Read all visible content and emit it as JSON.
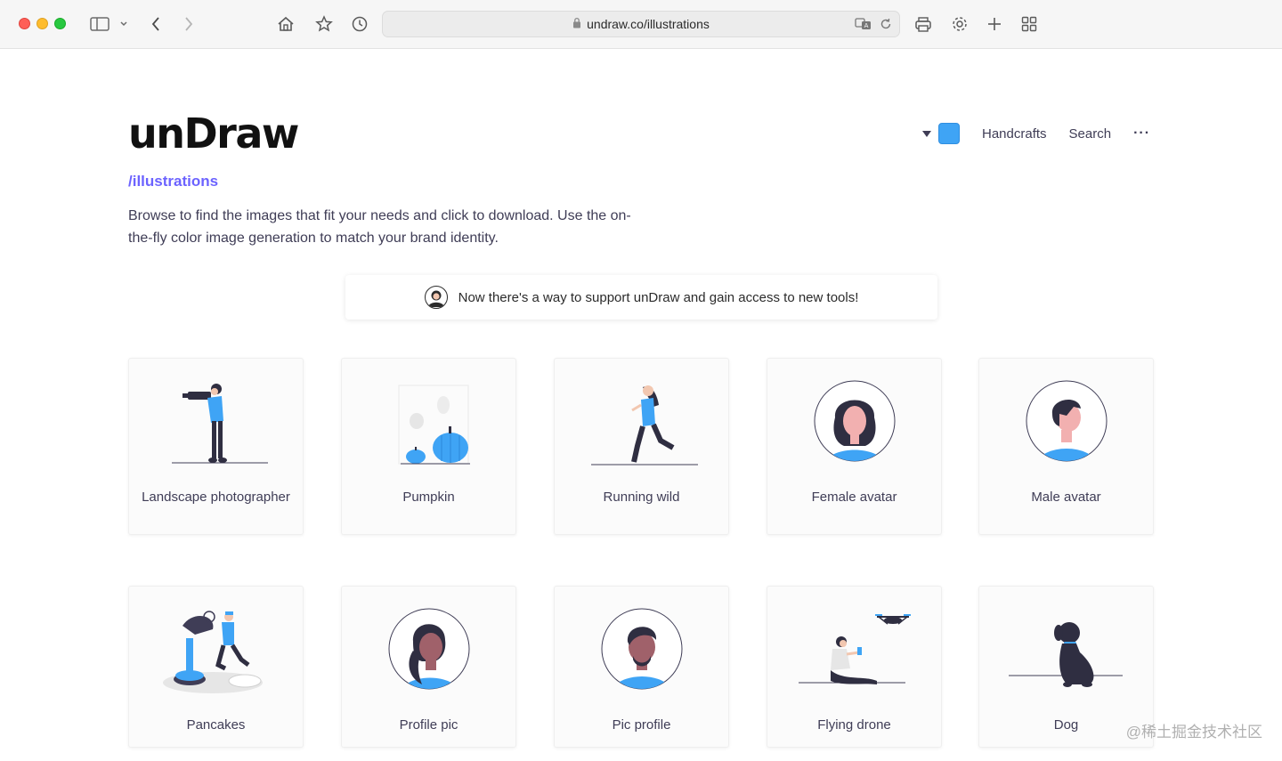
{
  "browser": {
    "url": "undraw.co/illustrations",
    "lock_icon": "lock-icon",
    "translate_icon": "translate-icon",
    "reload_icon": "reload-icon"
  },
  "site": {
    "logo": "unDraw",
    "subpath": "/illustrations",
    "description": "Browse to find the images that fit your needs and click to download. Use the on-the-fly color image generation to match your brand identity."
  },
  "nav": {
    "accent_color": "#3fa4f5",
    "links": [
      "Handcrafts",
      "Search"
    ],
    "more": "···"
  },
  "banner": {
    "text": "Now there's a way to support unDraw and gain access to new tools!"
  },
  "cards": [
    {
      "label": "Landscape photographer",
      "icon": "photographer-illustration"
    },
    {
      "label": "Pumpkin",
      "icon": "pumpkin-illustration"
    },
    {
      "label": "Running wild",
      "icon": "running-illustration"
    },
    {
      "label": "Female avatar",
      "icon": "female-avatar-illustration"
    },
    {
      "label": "Male avatar",
      "icon": "male-avatar-illustration"
    },
    {
      "label": "Pancakes",
      "icon": "pancakes-illustration"
    },
    {
      "label": "Profile pic",
      "icon": "profile-pic-illustration"
    },
    {
      "label": "Pic profile",
      "icon": "pic-profile-illustration"
    },
    {
      "label": "Flying drone",
      "icon": "drone-illustration"
    },
    {
      "label": "Dog",
      "icon": "dog-illustration"
    }
  ],
  "watermark": "@稀土掘金技术社区"
}
